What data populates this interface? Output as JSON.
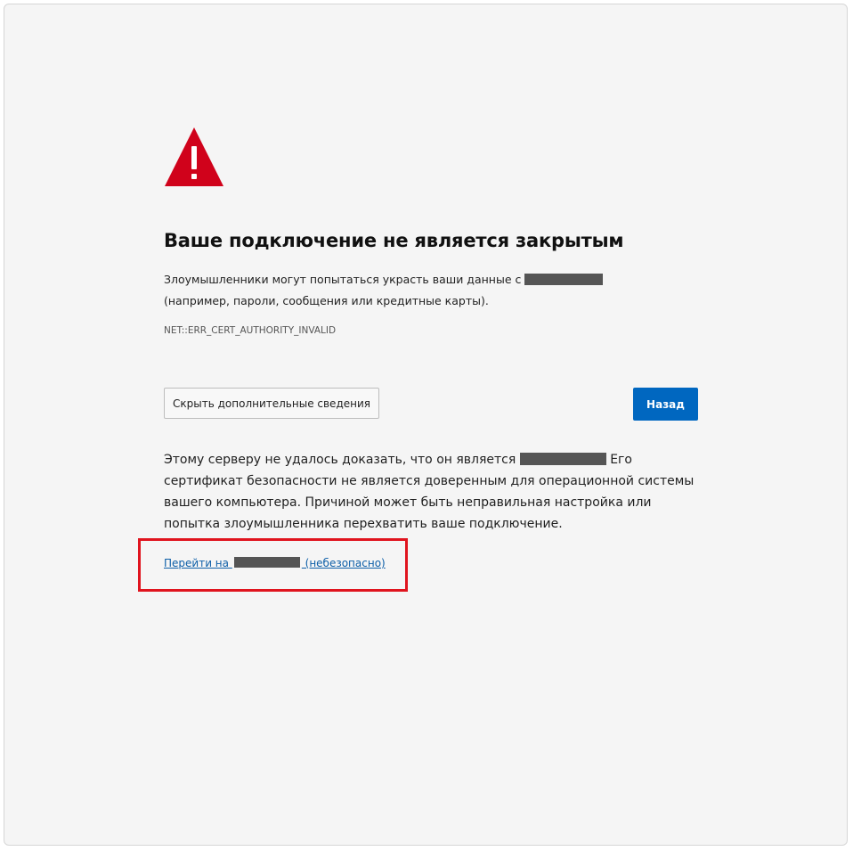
{
  "page": {
    "title": "Ваше подключение не является закрытым",
    "description_before": "Злоумышленники могут попытаться украсть ваши данные с ",
    "description_after": "(например, пароли, сообщения или кредитные карты).",
    "error_code": "NET::ERR_CERT_AUTHORITY_INVALID"
  },
  "buttons": {
    "details_label": "Скрыть дополнительные сведения",
    "back_label": "Назад"
  },
  "details": {
    "text_before": "Этому серверу не удалось доказать, что он является ",
    "text_after": " Его сертификат безопасности не является доверенным для операционной системы вашего компьютера. Причиной может быть неправильная настройка или попытка злоумышленника перехватить ваше подключение.",
    "proceed_prefix": "Перейти на ",
    "proceed_suffix": " (небезопасно)"
  },
  "icons": {
    "warning": "warning-triangle-icon"
  },
  "colors": {
    "warning_red": "#d0021b",
    "primary_blue": "#0067c0",
    "link_blue": "#0e5fa8",
    "highlight_red": "#e0141e",
    "redaction": "#555555"
  }
}
